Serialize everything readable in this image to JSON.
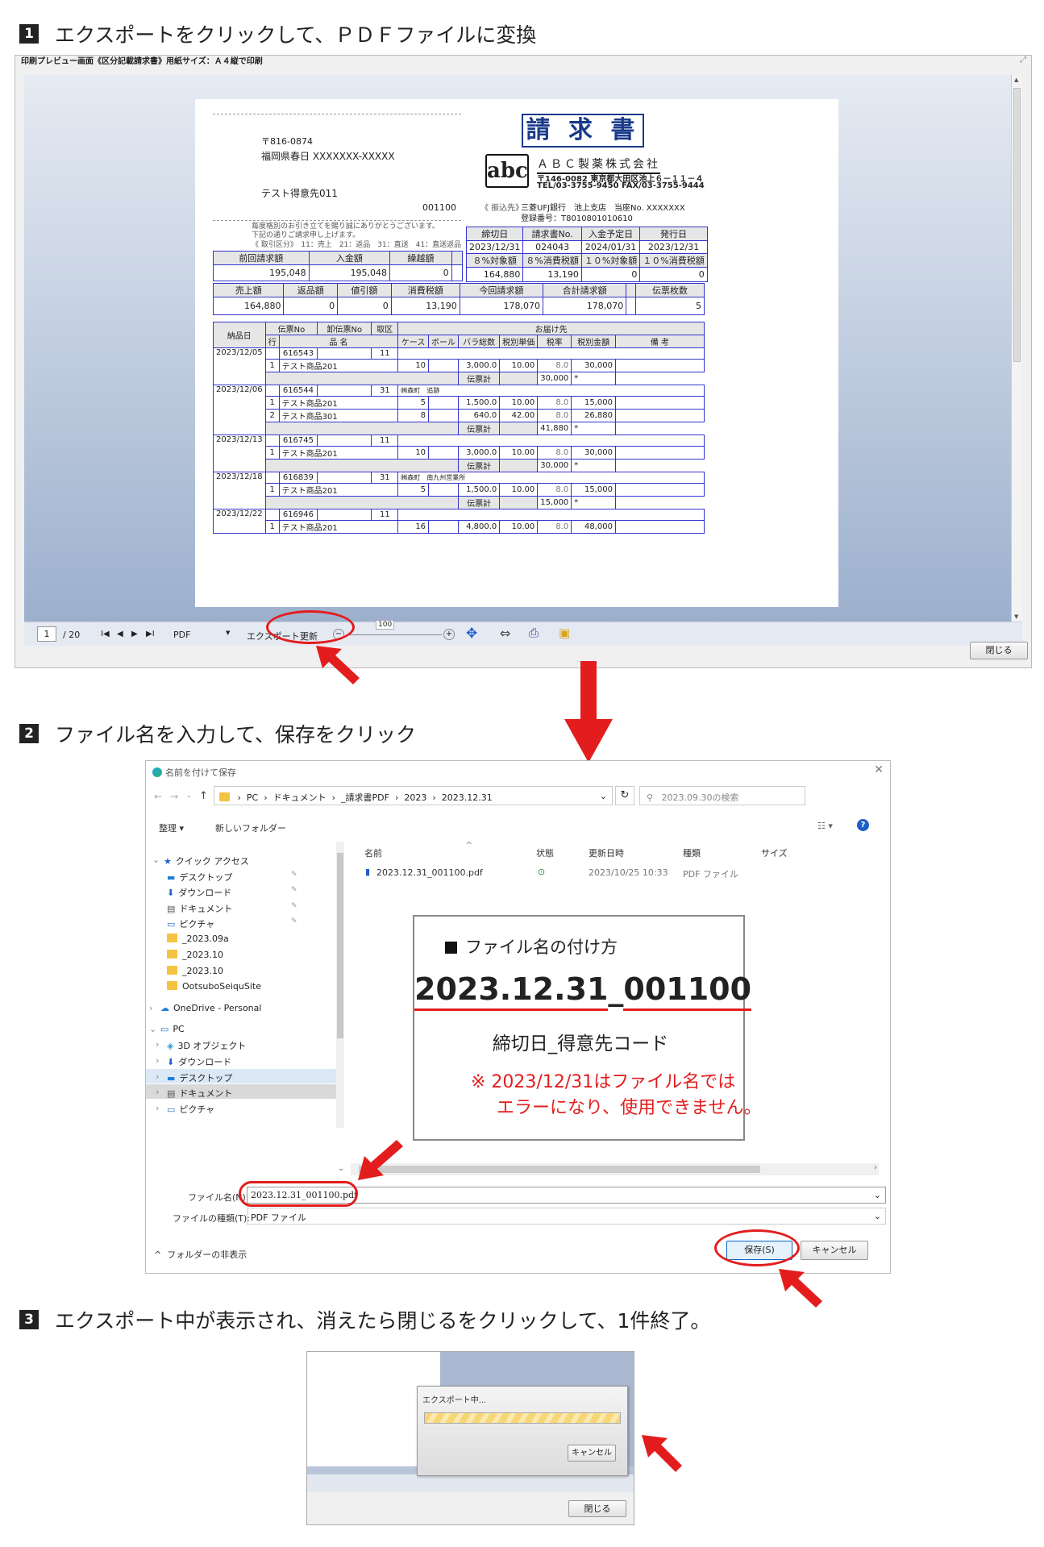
{
  "steps": [
    {
      "num": "1",
      "text": "エクスポートをクリックして、ＰＤＦファイルに変換"
    },
    {
      "num": "2",
      "text": "ファイル名を入力して、保存をクリック"
    },
    {
      "num": "3",
      "text": "エクスポート中が表示され、消えたら閉じるをクリックして、1件終了。"
    }
  ],
  "preview_window": {
    "title": "印刷プレビュー画面《区分記載請求書》用紙サイズ：Ａ４縦で印刷",
    "close_btn": "閉じる",
    "toolbar": {
      "page": "1",
      "total": "/ 20",
      "format": "PDF",
      "export": "エクスポート",
      "update": "更新",
      "zoom": "100"
    }
  },
  "invoice": {
    "title": "請 求 書",
    "postal": "〒816-0874",
    "address": "福岡県春日 XXXXXXX-XXXXX",
    "customer": "テスト得意先011",
    "customer_code": "001100",
    "logo": "abc",
    "company": "ＡＢＣ製薬株式会社",
    "company_addr": "〒146-0082 東京都大田区池上６－１１－４",
    "company_tel": "TEL/03-3755-9450 FAX/03-3755-9444",
    "bank_label": "《 振込先》",
    "bank": "三菱UFJ銀行　池上支店　当座No. XXXXXXX",
    "reg_no": "登録番号：T8010801010610",
    "greeting1": "毎度格別のお引き立てを賜り誠にありがとうございます。",
    "greeting2": "下記の通りご請求申し上げます。",
    "kubun": "《 取引区分》　11：売上　21：返品　31：直送　41：直送返品",
    "meta_headers": [
      "締切日",
      "請求書No.",
      "入金予定日",
      "発行日"
    ],
    "meta_values": [
      "2023/12/31",
      "024043",
      "2024/01/31",
      "2023/12/31"
    ],
    "tax_headers": [
      "８%対象額",
      "８%消費税額",
      "１０%対象額",
      "１０%消費税額"
    ],
    "tax_values": [
      "164,880",
      "13,190",
      "0",
      "0"
    ],
    "prev_headers": [
      "前回請求額",
      "入金額",
      "繰越額",
      ""
    ],
    "prev_values": [
      "195,048",
      "195,048",
      "0",
      ""
    ],
    "sum_headers": [
      "売上額",
      "返品額",
      "値引額",
      "消費税額",
      "今回請求額",
      "合計請求額",
      "",
      "伝票枚数"
    ],
    "sum_values": [
      "164,880",
      "0",
      "0",
      "13,190",
      "178,070",
      "178,070",
      "",
      "5"
    ],
    "detail_h1": [
      "納品日",
      "伝票No",
      "卸伝票No",
      "取区",
      "お届け先"
    ],
    "detail_h2": [
      "行",
      "品 名",
      "ケース",
      "ボール",
      "バラ総数",
      "税別単価",
      "税率",
      "税別金額",
      "備 考"
    ],
    "rows": [
      {
        "date": "2023/12/05",
        "slip": "616543",
        "kubun": "11",
        "dest": "",
        "lines": [
          {
            "no": "1",
            "name": "テスト商品201",
            "case": "10",
            "bara": "3,000.0",
            "price": "10.00",
            "rate": "8.0",
            "amount": "30,000"
          }
        ],
        "subtotal": "30,000"
      },
      {
        "date": "2023/12/06",
        "slip": "616544",
        "kubun": "31",
        "dest": "㈱森町　追跡",
        "lines": [
          {
            "no": "1",
            "name": "テスト商品201",
            "case": "5",
            "bara": "1,500.0",
            "price": "10.00",
            "rate": "8.0",
            "amount": "15,000"
          },
          {
            "no": "2",
            "name": "テスト商品301",
            "case": "8",
            "bara": "640.0",
            "price": "42.00",
            "rate": "8.0",
            "amount": "26,880"
          }
        ],
        "subtotal": "41,880"
      },
      {
        "date": "2023/12/13",
        "slip": "616745",
        "kubun": "11",
        "dest": "",
        "lines": [
          {
            "no": "1",
            "name": "テスト商品201",
            "case": "10",
            "bara": "3,000.0",
            "price": "10.00",
            "rate": "8.0",
            "amount": "30,000"
          }
        ],
        "subtotal": "30,000"
      },
      {
        "date": "2023/12/18",
        "slip": "616839",
        "kubun": "31",
        "dest": "㈱森町　南九州営業所",
        "lines": [
          {
            "no": "1",
            "name": "テスト商品201",
            "case": "5",
            "bara": "1,500.0",
            "price": "10.00",
            "rate": "8.0",
            "amount": "15,000"
          }
        ],
        "subtotal": "15,000"
      },
      {
        "date": "2023/12/22",
        "slip": "616946",
        "kubun": "11",
        "dest": "",
        "lines": [
          {
            "no": "1",
            "name": "テスト商品201",
            "case": "16",
            "bara": "4,800.0",
            "price": "10.00",
            "rate": "8.0",
            "amount": "48,000"
          }
        ],
        "subtotal": ""
      }
    ],
    "subtotal_label": "伝票計"
  },
  "save_dialog": {
    "title": "名前を付けて保存",
    "path": [
      "PC",
      "ドキュメント",
      "_請求書PDF",
      "2023",
      "2023.12.31"
    ],
    "search_placeholder": "2023.09.30の検索",
    "organize": "整理 ▾",
    "new_folder": "新しいフォルダー",
    "columns": [
      "名前",
      "状態",
      "更新日時",
      "種類",
      "サイズ"
    ],
    "file": {
      "name": "2023.12.31_001100.pdf",
      "date": "2023/10/25 10:33",
      "type": "PDF ファイル"
    },
    "nav": [
      "クイック アクセス",
      "デスクトップ",
      "ダウンロード",
      "ドキュメント",
      "ピクチャ",
      "_2023.09a",
      "_2023.10",
      "_2023.10",
      "OotsuboSeiquSite",
      "OneDrive - Personal",
      "PC",
      "3D オブジェクト",
      "ダウンロード",
      "デスクトップ",
      "ドキュメント",
      "ピクチャ"
    ],
    "filename_label": "ファイル名(N):",
    "filename": "2023.12.31_001100.pdf",
    "filetype_label": "ファイルの種類(T):",
    "filetype": "PDF ファイル",
    "hide_folders": "フォルダーの非表示",
    "save": "保存(S)",
    "cancel": "キャンセル",
    "info": {
      "heading": "ファイル名の付け方",
      "name_part1": "2023.12.31",
      "name_sep": "_",
      "name_part2": "001100",
      "explain": "締切日_得意先コード",
      "warn1": "※ 2023/12/31はファイル名では",
      "warn2": "エラーになり、使用できません。"
    }
  },
  "export_window": {
    "title": "エクスポート中...",
    "cancel": "キャンセル",
    "close": "閉じる"
  },
  "colors": {
    "red": "#e31d1d",
    "blue_border": "#3333cc",
    "accent": "#1a3a8a"
  }
}
